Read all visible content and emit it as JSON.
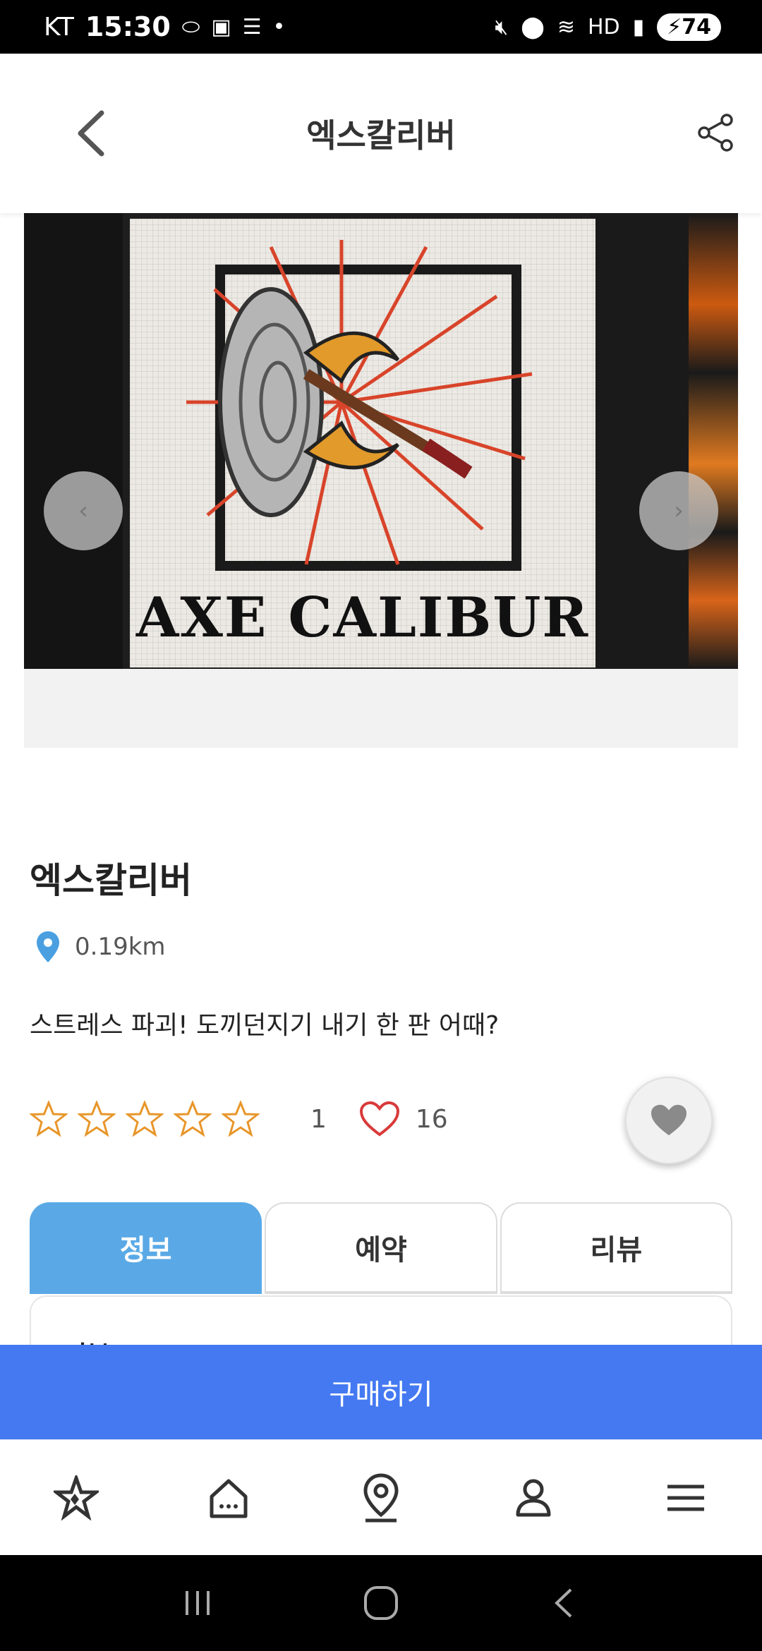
{
  "status_bar": {
    "carrier": "KT",
    "time": "15:30",
    "battery": "74"
  },
  "header": {
    "title": "엑스칼리버",
    "back_icon": "chevron-left-icon",
    "share_icon": "share-icon"
  },
  "carousel": {
    "banner_text": "AXE CALIBUR",
    "prev_label": "‹",
    "next_label": "›"
  },
  "place": {
    "name": "엑스칼리버",
    "distance": "0.19km",
    "tagline": "스트레스 파괴! 도끼던지기 내기 한 판 어때?",
    "rating_count": "1",
    "like_count": "16",
    "star_color": "#e8962a",
    "heart_color": "#d93a3a"
  },
  "tabs": [
    {
      "label": "정보",
      "active": true
    },
    {
      "label": "예약",
      "active": false
    },
    {
      "label": "리뷰",
      "active": false
    }
  ],
  "content": {
    "heading": "기본"
  },
  "buy_button": {
    "label": "구매하기",
    "color": "#4479f2"
  },
  "bottom_nav": [
    "star-icon",
    "home-icon",
    "map-pin-icon",
    "profile-icon",
    "menu-icon"
  ],
  "system_nav": [
    "recents-icon",
    "home-circle-icon",
    "back-icon"
  ]
}
